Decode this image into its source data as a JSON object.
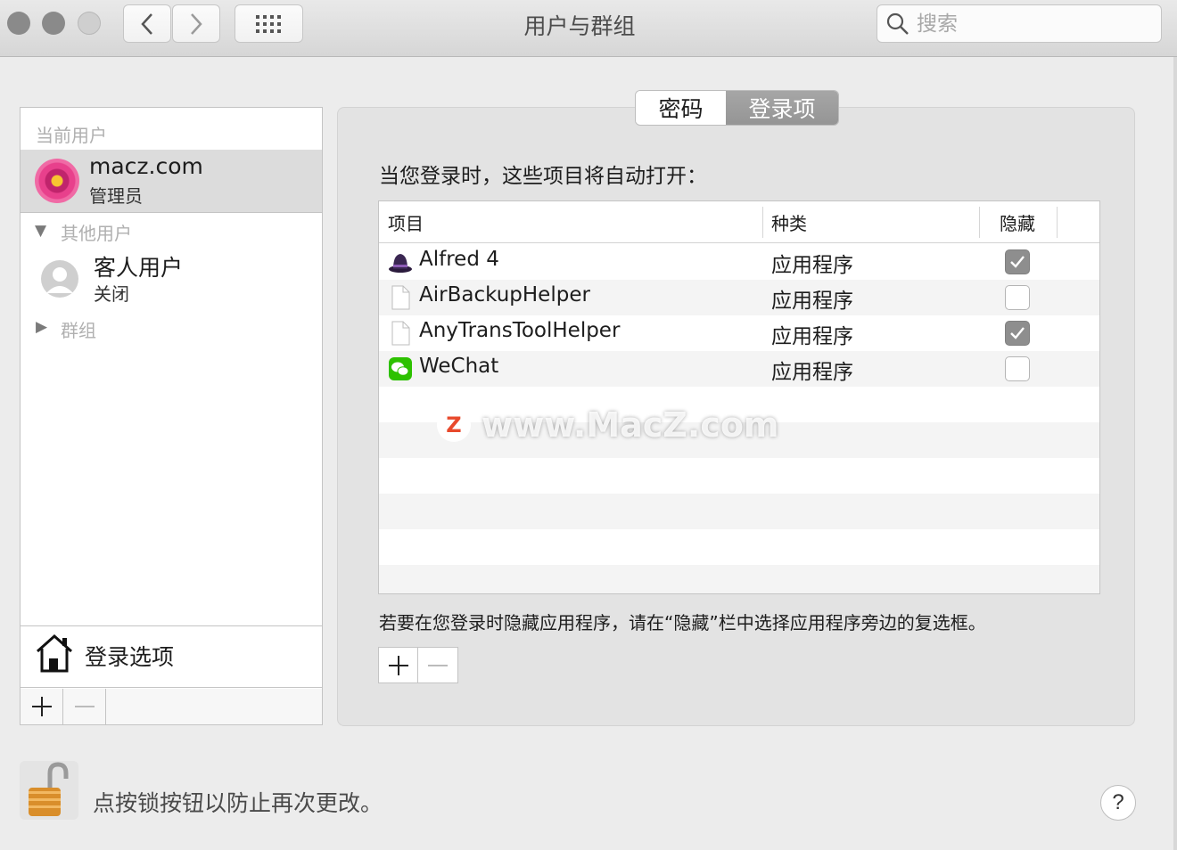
{
  "window": {
    "title": "用户与群组"
  },
  "toolbar": {
    "search_placeholder": "搜索"
  },
  "sidebar": {
    "current_header": "当前用户",
    "current_user": {
      "name": "macz.com",
      "role": "管理员"
    },
    "other_header": "其他用户",
    "guest": {
      "name": "客人用户",
      "status": "关闭"
    },
    "groups_header": "群组",
    "login_options": "登录选项"
  },
  "tabs": [
    {
      "label": "密码",
      "selected": false
    },
    {
      "label": "登录项",
      "selected": true
    }
  ],
  "panel": {
    "heading": "当您登录时，这些项目将自动打开：",
    "columns": [
      "项目",
      "种类",
      "隐藏"
    ],
    "items": [
      {
        "name": "Alfred 4",
        "kind": "应用程序",
        "hidden": true,
        "icon": "alfred-icon"
      },
      {
        "name": "AirBackupHelper",
        "kind": "应用程序",
        "hidden": false,
        "icon": "generic-file-icon"
      },
      {
        "name": "AnyTransToolHelper",
        "kind": "应用程序",
        "hidden": true,
        "icon": "generic-file-icon"
      },
      {
        "name": "WeChat",
        "kind": "应用程序",
        "hidden": false,
        "icon": "wechat-icon"
      }
    ],
    "hint": "若要在您登录时隐藏应用程序，请在“隐藏”栏中选择应用程序旁边的复选框。"
  },
  "watermark": {
    "logo": "Z",
    "text": "www.MacZ.com"
  },
  "footer": {
    "lock_text": "点按锁按钮以防止再次更改。",
    "help": "?"
  },
  "colors": {
    "accent_gray": "#959595",
    "row_alt": "#f4f4f4"
  }
}
